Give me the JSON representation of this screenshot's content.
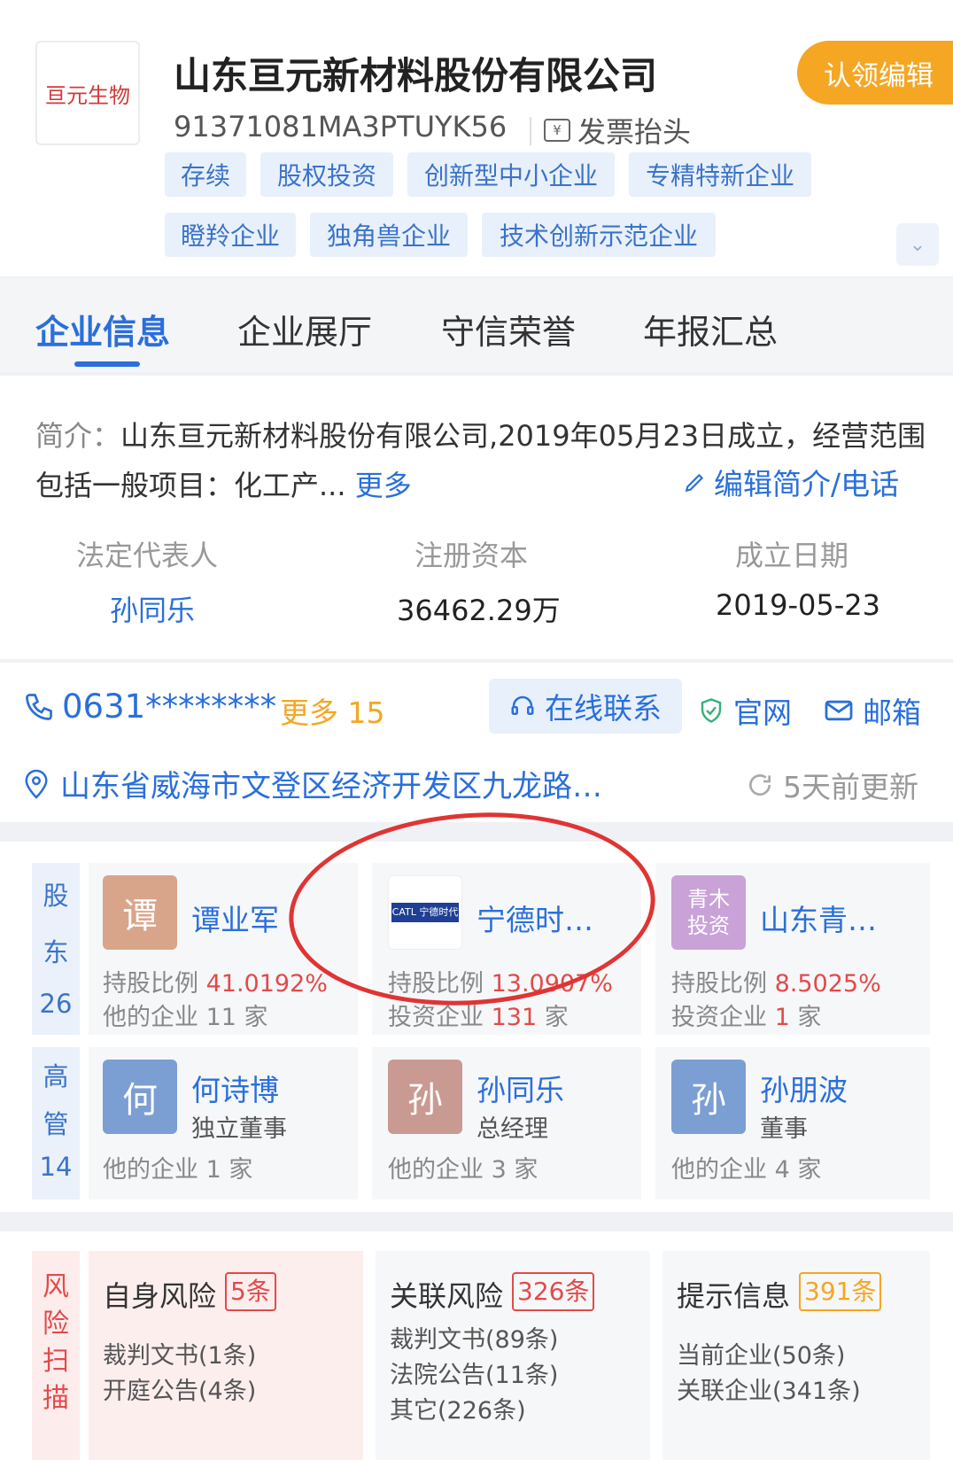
{
  "header": {
    "logo_text": "亘元生物",
    "company_name": "山东亘元新材料股份有限公司",
    "claim_button": "认领编辑",
    "credit_code": "91371081MA3PTUYK56",
    "invoice_icon_glyph": "¥",
    "invoice_label": "发票抬头",
    "tags": [
      "存续",
      "股权投资",
      "创新型中小企业",
      "专精特新企业",
      "瞪羚企业",
      "独角兽企业",
      "技术创新示范企业"
    ],
    "expand_glyph": "⌄"
  },
  "tabs": [
    {
      "label": "企业信息",
      "active": true
    },
    {
      "label": "企业展厅",
      "active": false
    },
    {
      "label": "守信荣誉",
      "active": false
    },
    {
      "label": "年报汇总",
      "active": false
    }
  ],
  "intro": {
    "label": "简介：",
    "text": "山东亘元新材料股份有限公司,2019年05月23日成立，经营范围包括一般项目：化工产...",
    "more": "更多",
    "edit_label": "编辑简介/电话",
    "edit_icon": "pencil-icon"
  },
  "key_info": {
    "legal_rep_label": "法定代表人",
    "legal_rep_value": "孙同乐",
    "capital_label": "注册资本",
    "capital_value": "36462.29万",
    "founded_label": "成立日期",
    "founded_value": "2019-05-23"
  },
  "contact": {
    "phone": "0631********",
    "phone_more": "更多 15",
    "online_contact": "在线联系",
    "website": "官网",
    "email": "邮箱",
    "address": "山东省威海市文登区经济开发区九龙路…",
    "updated": "5天前更新"
  },
  "shareholders": {
    "side_chars": [
      "股",
      "东"
    ],
    "count": "26",
    "items": [
      {
        "avatar_text": "谭",
        "avatar_color": "#d9a58a",
        "name": "谭业军",
        "ratio_label": "持股比例",
        "ratio": "41.0192%",
        "sub_label": "他的企业",
        "sub_count": "11",
        "sub_unit": "家",
        "sub_red": false
      },
      {
        "avatar_text": "CATL 宁德时代",
        "avatar_color": "#1f3f94",
        "name": "宁德时…",
        "ratio_label": "持股比例",
        "ratio": "13.0907%",
        "sub_label": "投资企业",
        "sub_count": "131",
        "sub_unit": "家",
        "sub_red": true
      },
      {
        "avatar_text": "青木投资",
        "avatar_color": "#c9a2d8",
        "name": "山东青…",
        "ratio_label": "持股比例",
        "ratio": "8.5025%",
        "sub_label": "投资企业",
        "sub_count": "1",
        "sub_unit": "家",
        "sub_red": true
      }
    ]
  },
  "executives": {
    "side_chars": [
      "高",
      "管"
    ],
    "count": "14",
    "items": [
      {
        "avatar_text": "何",
        "avatar_color": "#7b9ed3",
        "name": "何诗博",
        "role": "独立董事",
        "sub_label": "他的企业",
        "sub_count": "1",
        "sub_unit": "家"
      },
      {
        "avatar_text": "孙",
        "avatar_color": "#c99a92",
        "name": "孙同乐",
        "role": "总经理",
        "sub_label": "他的企业",
        "sub_count": "3",
        "sub_unit": "家"
      },
      {
        "avatar_text": "孙",
        "avatar_color": "#7b9ed3",
        "name": "孙朋波",
        "role": "董事",
        "sub_label": "他的企业",
        "sub_count": "4",
        "sub_unit": "家"
      }
    ]
  },
  "risk": {
    "side_chars": [
      "风",
      "险",
      "扫",
      "描"
    ],
    "items": [
      {
        "title": "自身风险",
        "badge": "5条",
        "badge_color": "#e24a4a",
        "bg": "#fdeeee",
        "lines": [
          "裁判文书(1条)",
          "开庭公告(4条)"
        ]
      },
      {
        "title": "关联风险",
        "badge": "326条",
        "badge_color": "#e24a4a",
        "bg": "#f6f7f9",
        "lines": [
          "裁判文书(89条)",
          "法院公告(11条)",
          "其它(226条)"
        ]
      },
      {
        "title": "提示信息",
        "badge": "391条",
        "badge_color": "#f5a623",
        "bg": "#f6f7f9",
        "lines": [
          "当前企业(50条)",
          "关联企业(341条)"
        ]
      }
    ]
  },
  "colors": {
    "accent": "#2a6fdb",
    "warning": "#f5a623",
    "danger": "#e24a4a",
    "annotation": "#e03434"
  }
}
